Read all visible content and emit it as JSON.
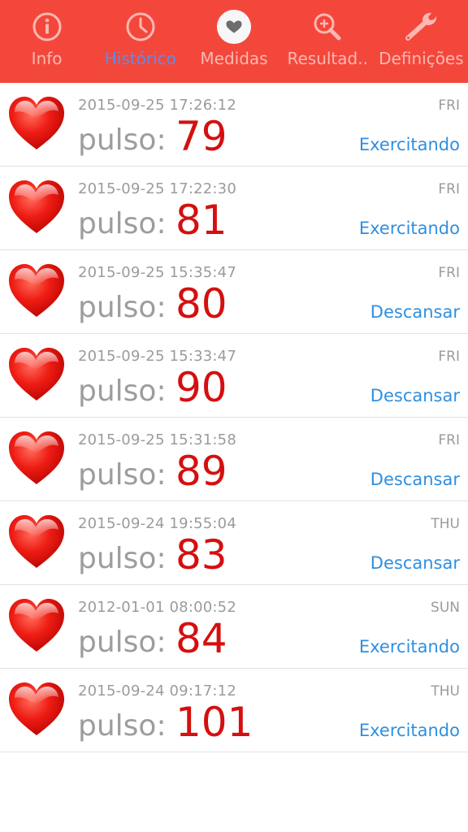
{
  "tabs": [
    {
      "label": "Info",
      "icon": "info-icon",
      "active": false
    },
    {
      "label": "Histórico",
      "icon": "clock-icon",
      "active": true
    },
    {
      "label": "Medidas",
      "icon": "heart-badge-icon",
      "active": false
    },
    {
      "label": "Resultad..",
      "icon": "search-icon",
      "active": false
    },
    {
      "label": "Definições",
      "icon": "wrench-icon",
      "active": false
    }
  ],
  "records": [
    {
      "timestamp": "2015-09-25 17:26:12",
      "day": "FRI",
      "pulse_label": "pulso:",
      "pulse": "79",
      "state": "Exercitando"
    },
    {
      "timestamp": "2015-09-25 17:22:30",
      "day": "FRI",
      "pulse_label": "pulso:",
      "pulse": "81",
      "state": "Exercitando"
    },
    {
      "timestamp": "2015-09-25 15:35:47",
      "day": "FRI",
      "pulse_label": "pulso:",
      "pulse": "80",
      "state": "Descansar"
    },
    {
      "timestamp": "2015-09-25 15:33:47",
      "day": "FRI",
      "pulse_label": "pulso:",
      "pulse": "90",
      "state": "Descansar"
    },
    {
      "timestamp": "2015-09-25 15:31:58",
      "day": "FRI",
      "pulse_label": "pulso:",
      "pulse": "89",
      "state": "Descansar"
    },
    {
      "timestamp": "2015-09-24 19:55:04",
      "day": "THU",
      "pulse_label": "pulso:",
      "pulse": "83",
      "state": "Descansar"
    },
    {
      "timestamp": "2012-01-01 08:00:52",
      "day": "SUN",
      "pulse_label": "pulso:",
      "pulse": "84",
      "state": "Exercitando"
    },
    {
      "timestamp": "2015-09-24 09:17:12",
      "day": "THU",
      "pulse_label": "pulso:",
      "pulse": "101",
      "state": "Exercitando"
    }
  ],
  "colors": {
    "tab_bar": "#f4473c",
    "tab_label": "#fbb8b2",
    "tab_label_active": "#5b8ee6",
    "pulse_value": "#d50f0f",
    "state_text": "#2f8fe0"
  }
}
